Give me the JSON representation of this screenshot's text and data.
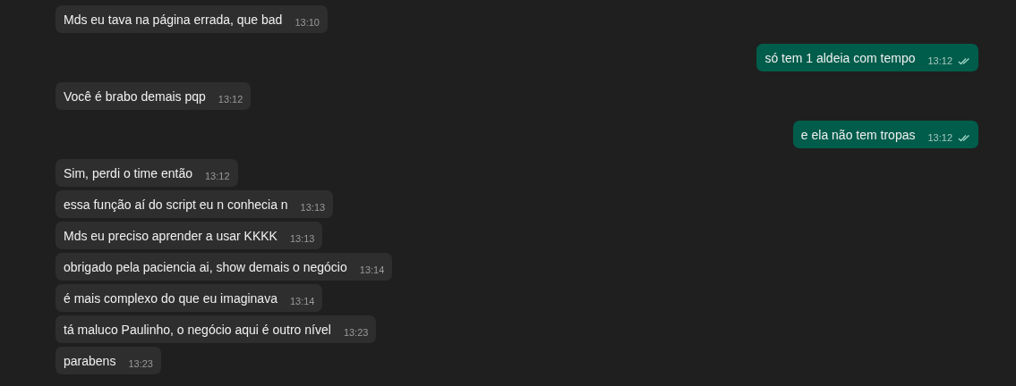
{
  "messages": [
    {
      "kind": "in",
      "text": "Mds eu tava na página errada, que bad",
      "time": "13:10"
    },
    {
      "kind": "out",
      "text": "só tem 1 aldeia com tempo",
      "time": "13:12",
      "read": true
    },
    {
      "kind": "in",
      "text": "Você é brabo demais pqp",
      "time": "13:12"
    },
    {
      "kind": "out",
      "text": "e ela não tem tropas",
      "time": "13:12",
      "read": true
    },
    {
      "kind": "in",
      "text": "Sim, perdi o time então",
      "time": "13:12"
    },
    {
      "kind": "in",
      "text": "essa função aí do script eu n conhecia n",
      "time": "13:13"
    },
    {
      "kind": "in",
      "text": "Mds eu preciso aprender a usar KKKK",
      "time": "13:13"
    },
    {
      "kind": "in",
      "text": "obrigado pela paciencia ai, show demais o negócio",
      "time": "13:14"
    },
    {
      "kind": "in",
      "text": "é mais complexo do que eu imaginava",
      "time": "13:14"
    },
    {
      "kind": "in",
      "text": "tá maluco Paulinho, o negócio aqui é outro nível",
      "time": "13:23"
    },
    {
      "kind": "in",
      "text": "parabens",
      "time": "13:23"
    }
  ]
}
